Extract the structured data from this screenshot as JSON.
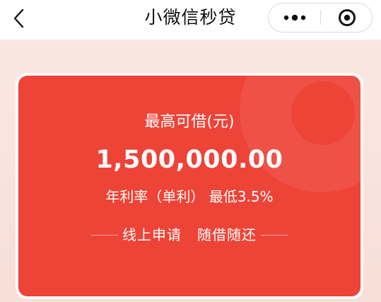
{
  "nav": {
    "title": "小微信秒贷",
    "back_icon": "chevron-left-icon",
    "more_icon": "more-dots-icon",
    "close_icon": "target-circle-icon"
  },
  "card": {
    "limit_label": "最高可借(元)",
    "limit_amount": "1,500,000.00",
    "rate_text": "年利率（单利） 最低3.5%",
    "slogan": "线上申请   随借随还"
  },
  "colors": {
    "card_red": "#ee4337",
    "page_bg": "#fbe8e3",
    "nav_bg": "#ffffff"
  }
}
